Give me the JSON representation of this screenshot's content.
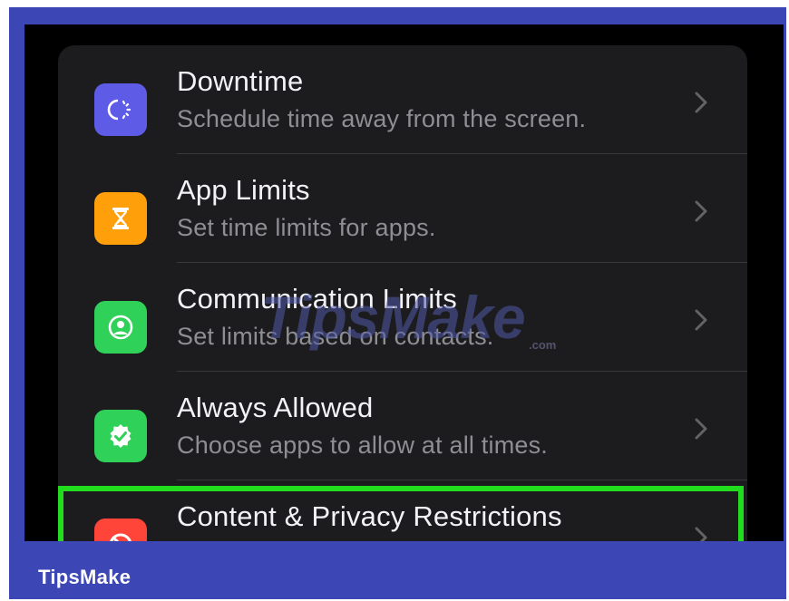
{
  "settings": {
    "items": [
      {
        "title": "Downtime",
        "subtitle": "Schedule time away from the screen.",
        "icon": "downtime-icon",
        "icon_color": "#5e5ce6"
      },
      {
        "title": "App Limits",
        "subtitle": "Set time limits for apps.",
        "icon": "hourglass-icon",
        "icon_color": "#ff9f0a"
      },
      {
        "title": "Communication Limits",
        "subtitle": "Set limits based on contacts.",
        "icon": "contact-icon",
        "icon_color": "#30d158"
      },
      {
        "title": "Always Allowed",
        "subtitle": "Choose apps to allow at all times.",
        "icon": "checkmark-badge-icon",
        "icon_color": "#30d158"
      },
      {
        "title": "Content & Privacy Restrictions",
        "subtitle": "",
        "icon": "restriction-icon",
        "icon_color": "#ff453a"
      }
    ]
  },
  "highlight_color": "#22dd1d",
  "watermark": {
    "text": "TipsMake",
    "small": ".com"
  },
  "brand": {
    "label": "TipsMake",
    "background": "#3c47b5"
  }
}
